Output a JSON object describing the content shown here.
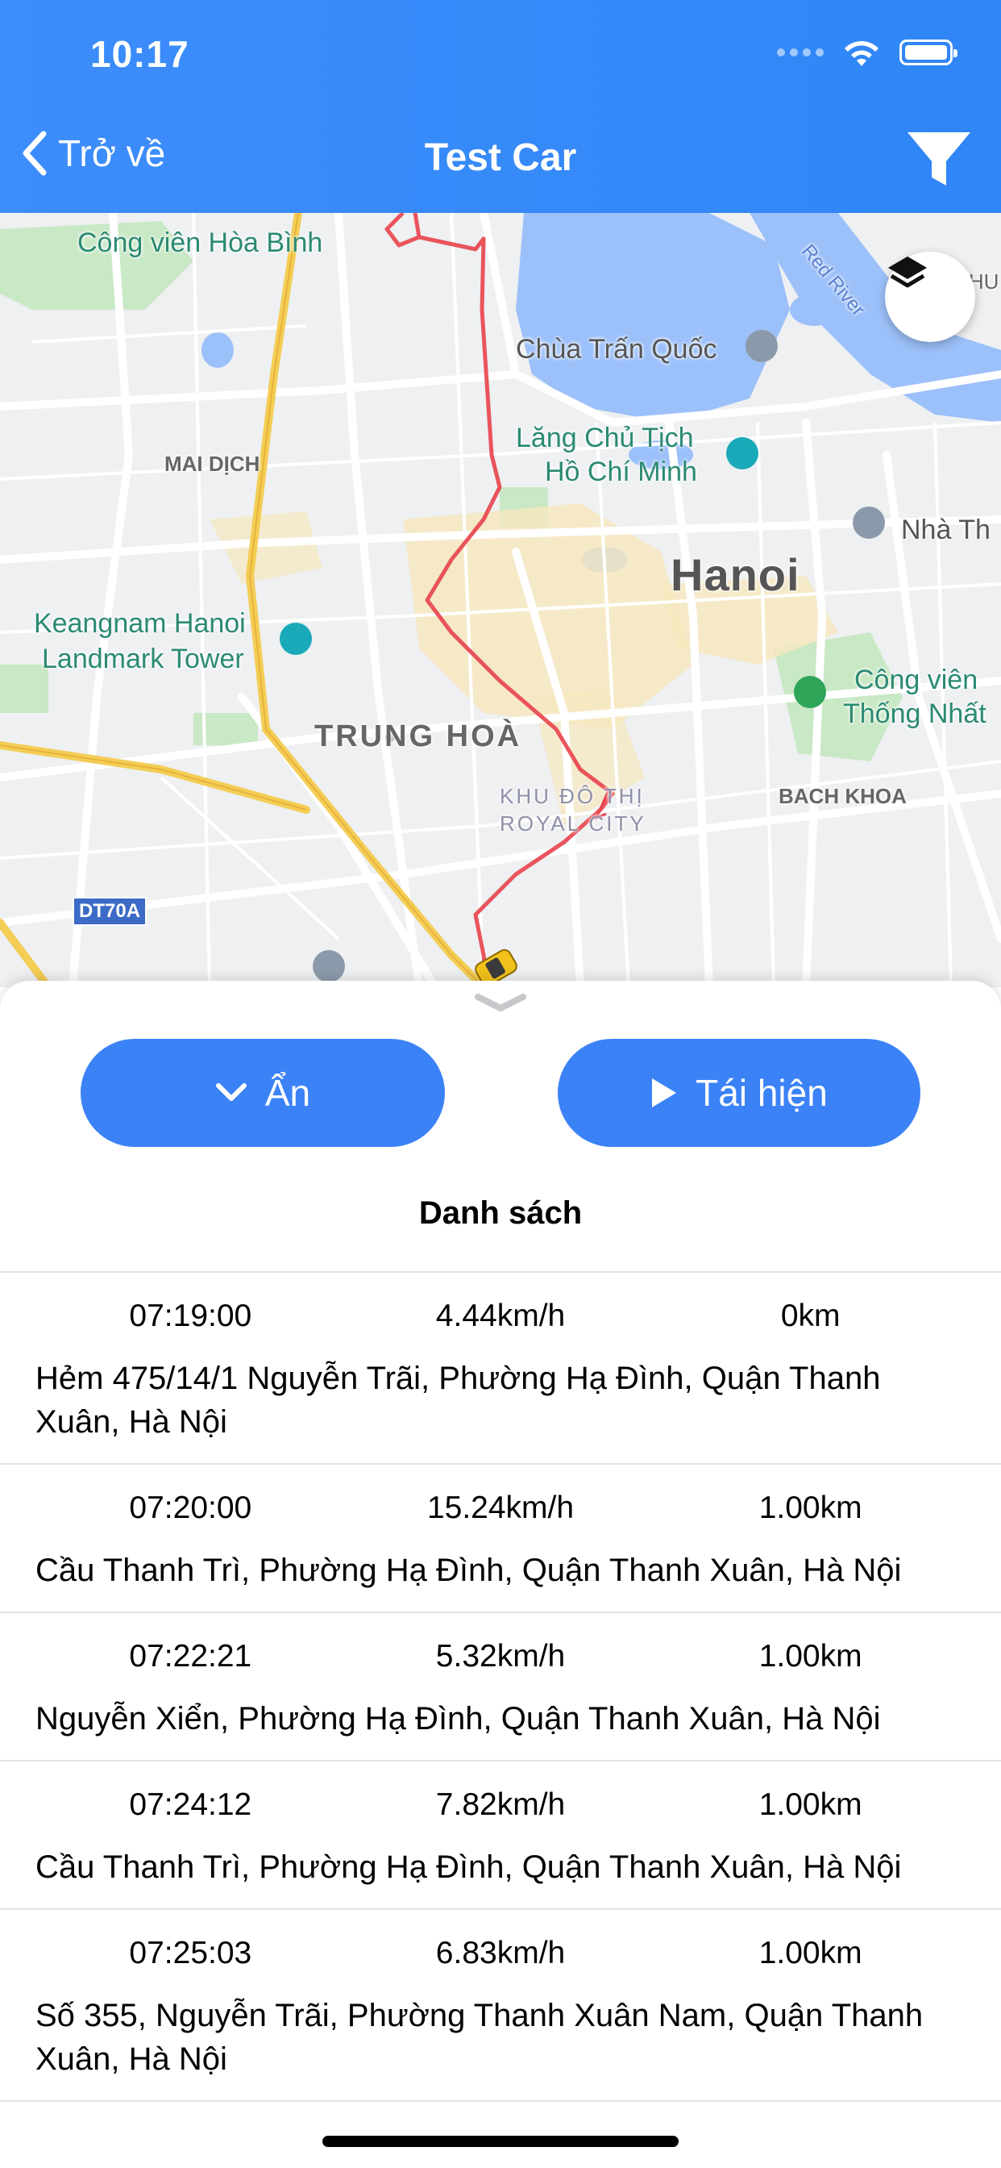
{
  "status_bar": {
    "time": "10:17"
  },
  "header": {
    "back_label": "Trở về",
    "title": "Test Car"
  },
  "map": {
    "labels": {
      "park_hoa_binh": "Công viên Hòa Bình",
      "chua_tran_quoc": "Chùa Trấn Quốc",
      "lang_line1": "Lăng Chủ Tịch",
      "lang_line2": "Hồ Chí Minh",
      "mai_dich": "MAI DỊCH",
      "hanoi": "Hanoi",
      "nha_th": "Nhà Th",
      "keangnam_line1": "Keangnam Hanoi",
      "keangnam_line2": "Landmark Tower",
      "cong_vien_line1": "Công viên",
      "cong_vien_line2": "Thống Nhất",
      "trung_hoa": "TRUNG HOÀ",
      "royal_line1": "KHU ĐÔ THỊ",
      "royal_line2": "ROYAL CITY",
      "bach_khoa": "BACH KHOA",
      "red_river": "Red River",
      "thu": "THU",
      "road_shield": "DT70A"
    },
    "route_color": "#e8424b"
  },
  "controls": {
    "hide_label": "Ẩn",
    "replay_label": "Tái hiện",
    "list_title": "Danh sách"
  },
  "trips": [
    {
      "time": "07:19:00",
      "speed": "4.44km/h",
      "distance": "0km",
      "address": "Hẻm 475/14/1 Nguyễn Trãi, Phường Hạ Đình, Quận Thanh Xuân, Hà Nội"
    },
    {
      "time": "07:20:00",
      "speed": "15.24km/h",
      "distance": "1.00km",
      "address": "Cầu Thanh Trì, Phường Hạ Đình, Quận Thanh Xuân, Hà Nội"
    },
    {
      "time": "07:22:21",
      "speed": "5.32km/h",
      "distance": "1.00km",
      "address": "Nguyễn Xiển, Phường Hạ Đình, Quận Thanh Xuân, Hà Nội"
    },
    {
      "time": "07:24:12",
      "speed": "7.82km/h",
      "distance": "1.00km",
      "address": "Cầu Thanh Trì, Phường Hạ Đình, Quận Thanh Xuân, Hà Nội"
    },
    {
      "time": "07:25:03",
      "speed": "6.83km/h",
      "distance": "1.00km",
      "address": "Số 355, Nguyễn Trãi, Phường Thanh Xuân Nam, Quận Thanh Xuân, Hà Nội"
    }
  ],
  "colors": {
    "header": "#3d8dfb",
    "button": "#3b82f6"
  }
}
